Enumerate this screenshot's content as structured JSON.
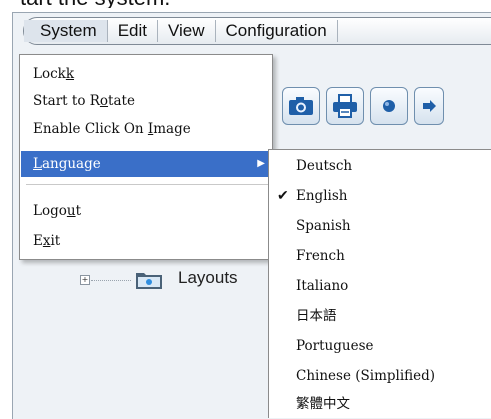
{
  "caption": "tart the system.",
  "menubar": {
    "items": [
      "System",
      "Edit",
      "View",
      "Configuration"
    ]
  },
  "toolbar": {
    "buttons": [
      {
        "icon": "camera-icon"
      },
      {
        "icon": "printer-icon"
      },
      {
        "icon": "record-icon"
      },
      {
        "icon": "arrow-icon"
      }
    ]
  },
  "tree": {
    "folder_label": "Layouts"
  },
  "system_menu": {
    "lock_label": "Lock",
    "lock_accel": "k",
    "rotate_label": "Start to R",
    "rotate_accel": "o",
    "rotate_rest": "tate",
    "click_label": "Enable Click On ",
    "click_accel": "I",
    "click_rest": "mage",
    "language_accel": "L",
    "language_rest": "anguage",
    "logout_label": "Logo",
    "logout_accel": "u",
    "logout_rest": "t",
    "exit_label": "E",
    "exit_accel": "x",
    "exit_rest": "it"
  },
  "language_menu": {
    "items": [
      {
        "label": "Deutsch",
        "checked": false
      },
      {
        "label": "English",
        "checked": true
      },
      {
        "label": "Spanish",
        "checked": false
      },
      {
        "label": "French",
        "checked": false
      },
      {
        "label": "Italiano",
        "checked": false
      },
      {
        "label": "日本語",
        "checked": false
      },
      {
        "label": "Portuguese",
        "checked": false
      },
      {
        "label": "Chinese (Simplified)",
        "checked": false
      },
      {
        "label": "繁體中文",
        "checked": false
      }
    ],
    "check_glyph": "✔"
  },
  "colors": {
    "highlight": "#3a6fc8",
    "window_bg": "#eef2f6"
  }
}
